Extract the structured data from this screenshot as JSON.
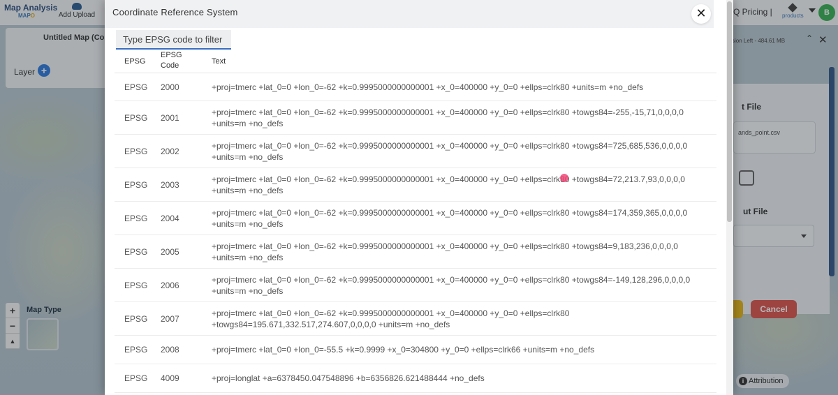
{
  "app": {
    "brand_line1": "Map Analysis",
    "brand_line2a": "MAP",
    "brand_line2b": "O",
    "add_upload": "Add Upload",
    "pricing": "Q  Pricing |",
    "products": "products",
    "avatar": "B",
    "map_title": "Untitled Map (Co",
    "layer_label": "Layer",
    "layer_add": "+",
    "zoom_in": "+",
    "zoom_out": "−",
    "compass": "▲",
    "map_type": "Map Type",
    "session": "sion Left - 484.61 MB",
    "collapse": "⌃",
    "close": "✕",
    "input_file_label": "t File",
    "input_file_value": "ands_point.csv",
    "output_file_label": "ut File",
    "cancel": "Cancel",
    "attribution": "Attribution"
  },
  "modal": {
    "title": "Coordinate Reference System",
    "close": "✕",
    "search_placeholder": "Type EPSG code to filter",
    "headers": {
      "epsg": "EPSG",
      "code_line1": "EPSG",
      "code_line2": "Code",
      "text": "Text"
    },
    "rows": [
      {
        "epsg": "EPSG",
        "code": "2000",
        "text": "+proj=tmerc +lat_0=0 +lon_0=-62 +k=0.9995000000000001 +x_0=400000 +y_0=0 +ellps=clrk80 +units=m +no_defs"
      },
      {
        "epsg": "EPSG",
        "code": "2001",
        "text": "+proj=tmerc +lat_0=0 +lon_0=-62 +k=0.9995000000000001 +x_0=400000 +y_0=0 +ellps=clrk80 +towgs84=-255,-15,71,0,0,0,0 +units=m +no_defs"
      },
      {
        "epsg": "EPSG",
        "code": "2002",
        "text": "+proj=tmerc +lat_0=0 +lon_0=-62 +k=0.9995000000000001 +x_0=400000 +y_0=0 +ellps=clrk80 +towgs84=725,685,536,0,0,0,0 +units=m +no_defs"
      },
      {
        "epsg": "EPSG",
        "code": "2003",
        "text": "+proj=tmerc +lat_0=0 +lon_0=-62 +k=0.9995000000000001 +x_0=400000 +y_0=0 +ellps=clrk80 +towgs84=72,213.7,93,0,0,0,0 +units=m +no_defs"
      },
      {
        "epsg": "EPSG",
        "code": "2004",
        "text": "+proj=tmerc +lat_0=0 +lon_0=-62 +k=0.9995000000000001 +x_0=400000 +y_0=0 +ellps=clrk80 +towgs84=174,359,365,0,0,0,0 +units=m +no_defs"
      },
      {
        "epsg": "EPSG",
        "code": "2005",
        "text": "+proj=tmerc +lat_0=0 +lon_0=-62 +k=0.9995000000000001 +x_0=400000 +y_0=0 +ellps=clrk80 +towgs84=9,183,236,0,0,0,0 +units=m +no_defs"
      },
      {
        "epsg": "EPSG",
        "code": "2006",
        "text": "+proj=tmerc +lat_0=0 +lon_0=-62 +k=0.9995000000000001 +x_0=400000 +y_0=0 +ellps=clrk80 +towgs84=-149,128,296,0,0,0,0 +units=m +no_defs"
      },
      {
        "epsg": "EPSG",
        "code": "2007",
        "text": "+proj=tmerc +lat_0=0 +lon_0=-62 +k=0.9995000000000001 +x_0=400000 +y_0=0 +ellps=clrk80 +towgs84=195.671,332.517,274.607,0,0,0,0 +units=m +no_defs"
      },
      {
        "epsg": "EPSG",
        "code": "2008",
        "text": "+proj=tmerc +lat_0=0 +lon_0=-55.5 +k=0.9999 +x_0=304800 +y_0=0 +ellps=clrk66 +units=m +no_defs"
      },
      {
        "epsg": "EPSG",
        "code": "4009",
        "text": "+proj=longlat +a=6378450.047548896 +b=6356826.621488444 +no_defs"
      }
    ]
  },
  "colors": {
    "accent_blue": "#1e6fd9",
    "cancel_red": "#d9463e",
    "avatar_green": "#27a844",
    "cursor_pink": "#f03c6e"
  }
}
